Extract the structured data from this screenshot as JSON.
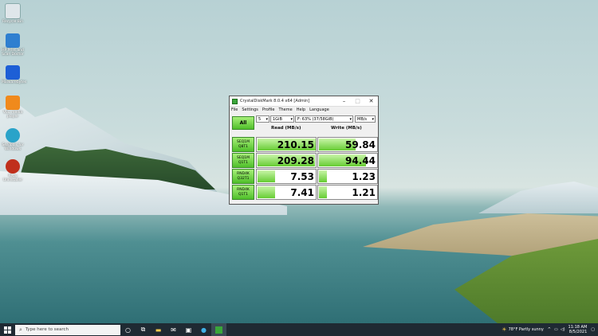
{
  "desktop": {
    "icons": [
      {
        "label": "Recycle Bin",
        "color": "#dfe6ea"
      },
      {
        "label": "HP Print and Scan Doctor",
        "color": "#2f7fd0"
      },
      {
        "label": "Malwarebytes",
        "color": "#1d5fd6"
      },
      {
        "label": "VLC media player",
        "color": "#f08a1c"
      },
      {
        "label": "SeaTools for Windows",
        "color": "#2aa3c9"
      },
      {
        "label": "Revo Uninstaller",
        "color": "#c0301c"
      }
    ]
  },
  "window": {
    "title": "CrystalDiskMark 8.0.4 x64 [Admin]",
    "menu": [
      "File",
      "Settings",
      "Profile",
      "Theme",
      "Help",
      "Language"
    ],
    "all_label": "All",
    "count": "5",
    "size": "1GiB",
    "drive": "F: 63% (37/58GiB)",
    "unit": "MB/s",
    "read_header": "Read (MB/s)",
    "write_header": "Write (MB/s)",
    "rows": [
      {
        "line1": "SEQ1M",
        "line2": "Q8T1",
        "read": "210.15",
        "write": "59.84",
        "read_fill": 0.98,
        "write_fill": 0.62
      },
      {
        "line1": "SEQ1M",
        "line2": "Q1T1",
        "read": "209.28",
        "write": "94.44",
        "read_fill": 0.97,
        "write_fill": 0.8
      },
      {
        "line1": "RND4K",
        "line2": "Q32T1",
        "read": "7.53",
        "write": "1.23",
        "read_fill": 0.3,
        "write_fill": 0.14
      },
      {
        "line1": "RND4K",
        "line2": "Q1T1",
        "read": "7.41",
        "write": "1.21",
        "read_fill": 0.3,
        "write_fill": 0.14
      }
    ]
  },
  "taskbar": {
    "search_placeholder": "Type here to search",
    "weather": "78°F  Partly sunny",
    "time": "11:18 AM",
    "date": "8/5/2021"
  }
}
